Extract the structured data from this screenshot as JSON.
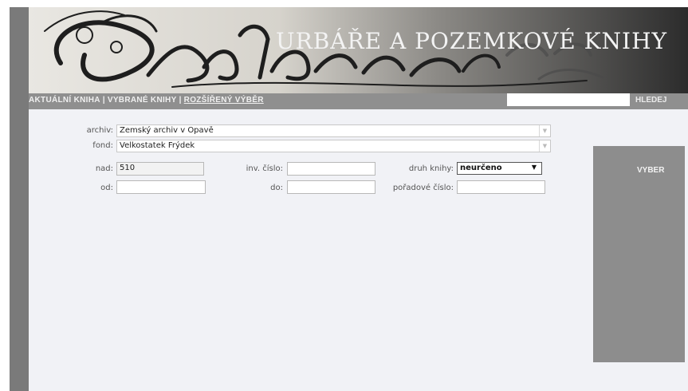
{
  "banner": {
    "title": "URBÁŘE A POZEMKOVÉ KNIHY"
  },
  "nav": {
    "links": [
      "AKTUÁLNÍ KNIHA",
      "VYBRANÉ KNIHY",
      "ROZŠÍŘENÝ VÝBĚR"
    ],
    "separator": "|",
    "active_index": 2,
    "search_value": "",
    "search_button": "HLEDEJ"
  },
  "form": {
    "archiv_label": "archiv:",
    "archiv_value": "Zemský archiv v Opavě",
    "fond_label": "fond:",
    "fond_value": "Velkostatek Frýdek",
    "nad_label": "nad:",
    "nad_value": "510",
    "inv_label": "inv. číslo:",
    "inv_value": "",
    "druh_label": "druh knihy:",
    "druh_value": "neurčeno",
    "od_label": "od:",
    "od_value": "",
    "do_label": "do:",
    "do_value": "",
    "poradove_label": "pořadové číslo:",
    "poradove_value": ""
  },
  "side": {
    "button": "VYBER"
  },
  "colors": {
    "frame": "#7a7a7a",
    "navbar": "#8f8f8f",
    "content": "#f1f2f6",
    "sidepanel": "#8d8d8d"
  },
  "icons": {
    "select_arrow": "chevron-down-icon",
    "dropdown_arrow": "triangle-down-icon"
  }
}
